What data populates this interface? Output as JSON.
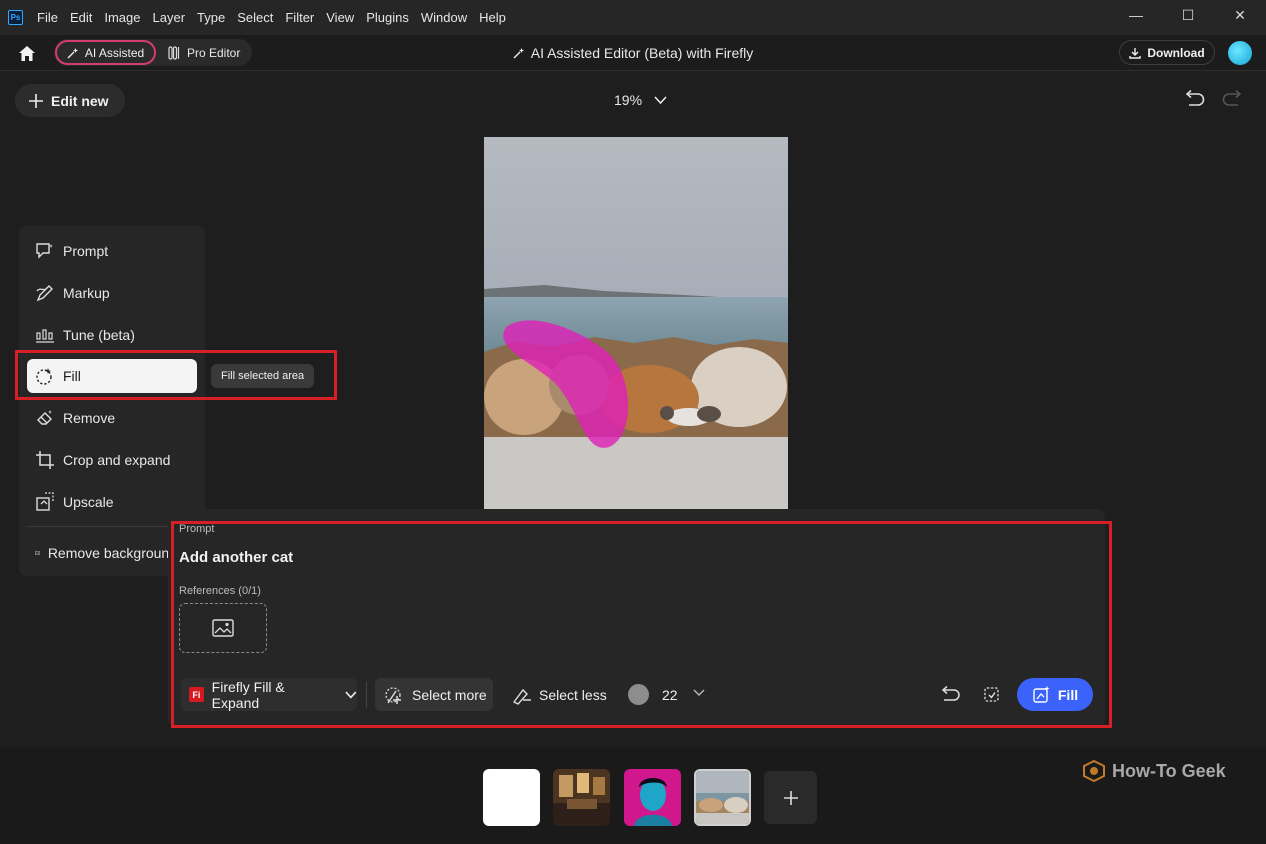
{
  "app": {
    "logo": "Ps",
    "menu": [
      "File",
      "Edit",
      "Image",
      "Layer",
      "Type",
      "Select",
      "Filter",
      "View",
      "Plugins",
      "Window",
      "Help"
    ],
    "window_controls": {
      "minimize": "—",
      "maximize": "☐",
      "close": "✕"
    }
  },
  "modebar": {
    "ai_assisted": "AI Assisted",
    "pro_editor": "Pro Editor",
    "title": "AI Assisted Editor (Beta) with Firefly",
    "download": "Download"
  },
  "toolbar": {
    "edit_new": "Edit new",
    "zoom": "19%"
  },
  "tools": {
    "items": [
      {
        "label": "Prompt",
        "icon": "prompt-icon"
      },
      {
        "label": "Markup",
        "icon": "markup-icon"
      },
      {
        "label": "Tune (beta)",
        "icon": "tune-icon"
      },
      {
        "label": "Fill",
        "icon": "fill-icon",
        "active": true
      },
      {
        "label": "Remove",
        "icon": "remove-icon"
      },
      {
        "label": "Crop and expand",
        "icon": "crop-icon"
      },
      {
        "label": "Upscale",
        "icon": "upscale-icon"
      },
      {
        "label": "Remove background",
        "icon": "remove-background-icon"
      }
    ],
    "tooltip": "Fill selected area"
  },
  "prompt_panel": {
    "label": "Prompt",
    "text": "Add another cat",
    "references_label": "References (0/1)",
    "model": "Firefly Fill & Expand",
    "model_badge": "Fi",
    "select_more": "Select more",
    "select_less": "Select less",
    "brush_size": "22",
    "fill_button": "Fill"
  },
  "watermark": "How-To Geek",
  "colors": {
    "accent_blue": "#3b63fb",
    "highlight_red": "#d81f26",
    "ai_mode_border": "#d33d6b",
    "selection_magenta": "#e020b8"
  }
}
